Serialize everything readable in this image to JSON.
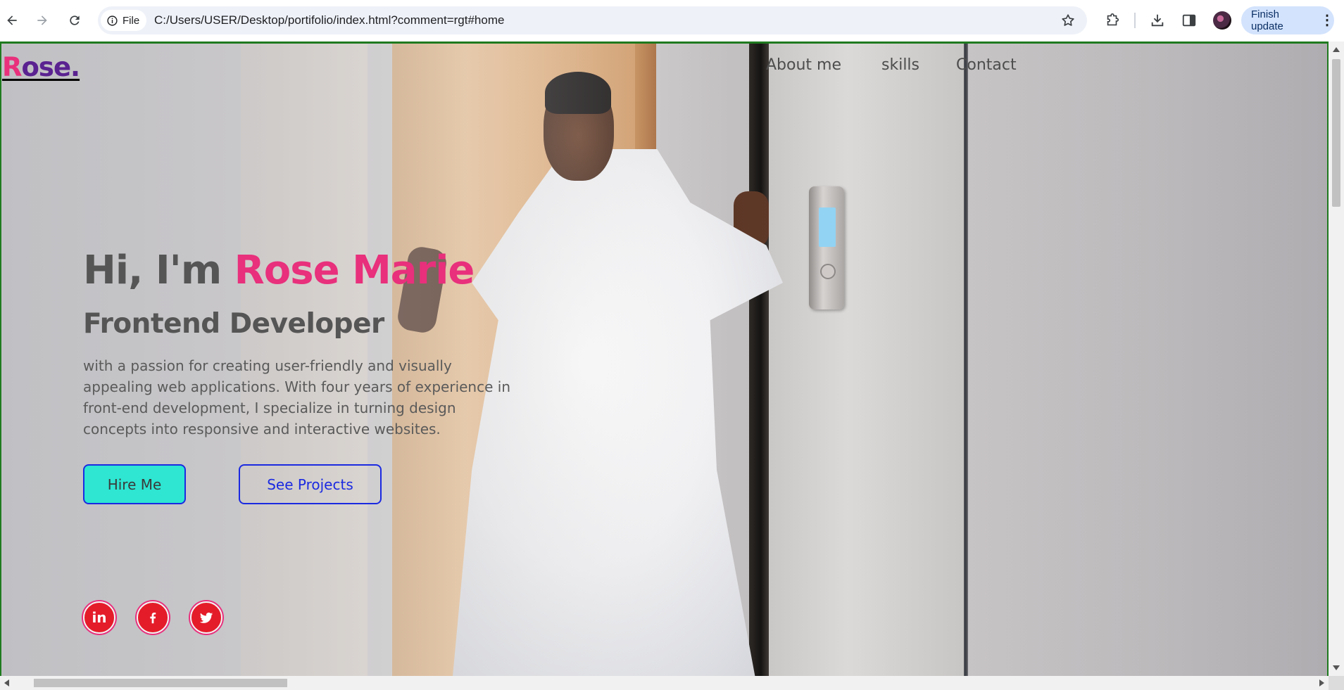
{
  "browser": {
    "back_icon": "arrow-left-icon",
    "forward_icon": "arrow-right-icon",
    "reload_icon": "reload-icon",
    "site_info_label": "File",
    "url": "C:/Users/USER/Desktop/portifolio/index.html?comment=rgt#home",
    "update_button_label": "Finish update"
  },
  "page": {
    "logo_first": "R",
    "logo_rest": "ose.",
    "nav": {
      "about": "About me",
      "skills": "skills",
      "contact": "Contact"
    },
    "hero": {
      "greeting": "Hi, I'm ",
      "name": "Rose Marie",
      "role": "Frontend Developer",
      "description": "with a passion for creating user-friendly and visually appealing web applications. With four years of experience in front-end development, I specialize in turning design concepts into responsive and interactive websites.",
      "hire_button": "Hire Me",
      "projects_button": "See Projects"
    },
    "social": {
      "linkedin_text": "in",
      "icons": [
        "linkedin-icon",
        "facebook-icon",
        "twitter-icon"
      ]
    }
  },
  "colors": {
    "accent_pink": "#e8307c",
    "logo_purple": "#5a2290",
    "hire_button_bg": "#2ee6d2",
    "button_border": "#1b2ae0",
    "social_bg": "#e41c2a"
  }
}
